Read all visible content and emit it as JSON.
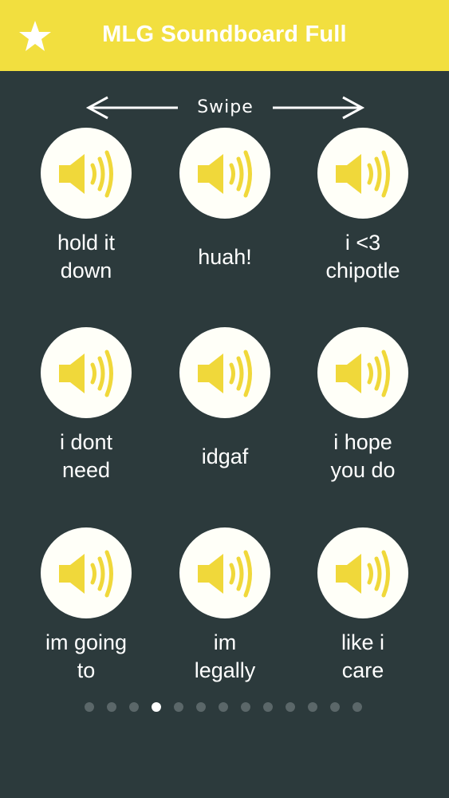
{
  "header": {
    "title": "MLG Soundboard Full",
    "star_icon": "star-icon",
    "background": "#f2df3f"
  },
  "swipe_hint": {
    "label": "Swipe"
  },
  "sounds": [
    {
      "label": "hold it\ndown"
    },
    {
      "label": "huah!"
    },
    {
      "label": "i <3\nchipotle"
    },
    {
      "label": "i dont\nneed"
    },
    {
      "label": "idgaf"
    },
    {
      "label": "i hope\nyou do"
    },
    {
      "label": "im going\nto"
    },
    {
      "label": "im\nlegally"
    },
    {
      "label": "like i\ncare"
    }
  ],
  "pagination": {
    "total": 13,
    "active_index": 3
  },
  "colors": {
    "background": "#2c3a3c",
    "accent": "#f2df3f",
    "speaker": "#f0d83a"
  }
}
